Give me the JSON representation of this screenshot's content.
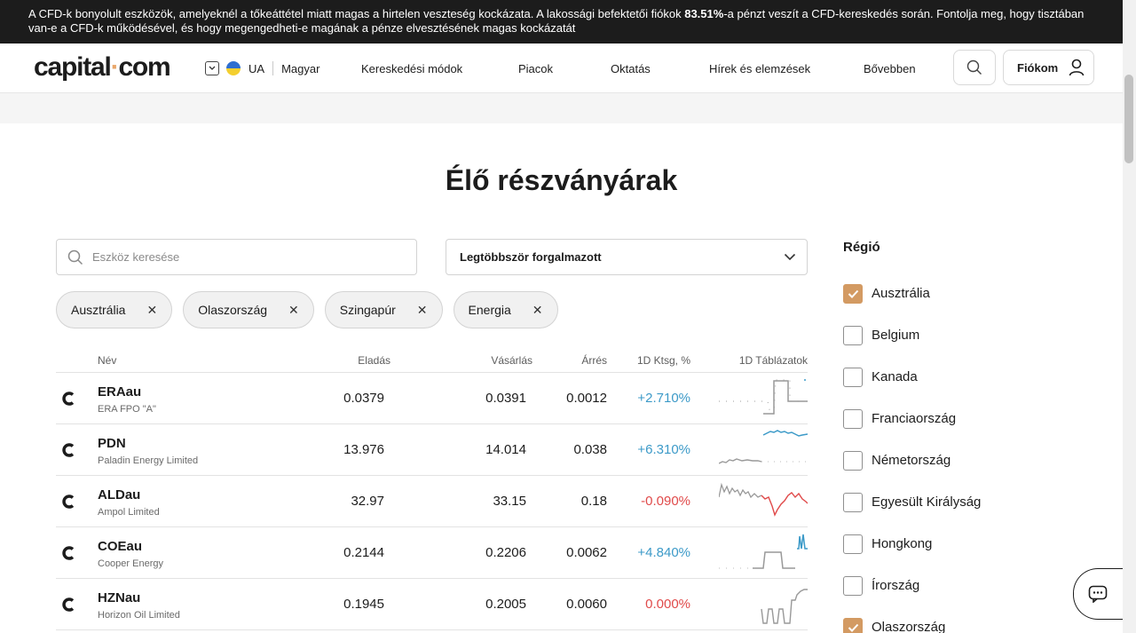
{
  "warning": {
    "text_before": "A CFD-k bonyolult eszközök, amelyeknél a tőkeáttétel miatt magas a hirtelen veszteség kockázata. A lakossági befektetői fiókok ",
    "percent": "83.51%",
    "text_after": "-a pénzt veszít a CFD-kereskedés során. Fontolja meg, hogy tisztában van-e a CFD-k működésével, és hogy megengedheti-e magának a pénze elvesztésének magas kockázatát"
  },
  "header": {
    "logo_left": "capital",
    "logo_dot": "·",
    "logo_right": "com",
    "country": "UA",
    "language": "Magyar",
    "menu": [
      "Kereskedési módok",
      "Piacok",
      "Oktatás",
      "Hírek és elemzések",
      "Bővebben"
    ],
    "account": "Fiókom"
  },
  "page": {
    "title": "Élő részványárak",
    "search_placeholder": "Eszköz keresése",
    "sort_label": "Legtöbbször forgalmazott"
  },
  "filters": [
    "Ausztrália",
    "Olaszország",
    "Szingapúr",
    "Energia"
  ],
  "table": {
    "columns": [
      "Név",
      "Eladás",
      "Vásárlás",
      "Árrés",
      "1D Ktsg, %",
      "1D Táblázatok"
    ],
    "rows": [
      {
        "symbol": "ERAau",
        "name": "ERA FPO \"A\"",
        "sell": "0.0379",
        "buy": "0.0391",
        "spread": "0.0012",
        "change": "+2.710%",
        "trend": "pos"
      },
      {
        "symbol": "PDN",
        "name": "Paladin Energy Limited",
        "sell": "13.976",
        "buy": "14.014",
        "spread": "0.038",
        "change": "+6.310%",
        "trend": "pos"
      },
      {
        "symbol": "ALDau",
        "name": "Ampol Limited",
        "sell": "32.97",
        "buy": "33.15",
        "spread": "0.18",
        "change": "-0.090%",
        "trend": "neg"
      },
      {
        "symbol": "COEau",
        "name": "Cooper Energy",
        "sell": "0.2144",
        "buy": "0.2206",
        "spread": "0.0062",
        "change": "+4.840%",
        "trend": "pos"
      },
      {
        "symbol": "HZNau",
        "name": "Horizon Oil Limited",
        "sell": "0.1945",
        "buy": "0.2005",
        "spread": "0.0060",
        "change": "0.000%",
        "trend": "neg"
      }
    ]
  },
  "region": {
    "title": "Régió",
    "items": [
      {
        "label": "Ausztrália",
        "checked": true
      },
      {
        "label": "Belgium",
        "checked": false
      },
      {
        "label": "Kanada",
        "checked": false
      },
      {
        "label": "Franciaország",
        "checked": false
      },
      {
        "label": "Németország",
        "checked": false
      },
      {
        "label": "Egyesült Királyság",
        "checked": false
      },
      {
        "label": "Hongkong",
        "checked": false
      },
      {
        "label": "Írország",
        "checked": false
      },
      {
        "label": "Olaszország",
        "checked": true
      }
    ]
  },
  "colors": {
    "positive": "#3c9ac8",
    "negative": "#e04a4a",
    "accent": "#d39a62"
  }
}
